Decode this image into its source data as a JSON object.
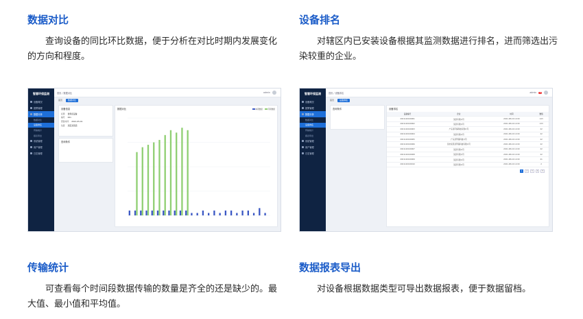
{
  "sections": {
    "compare": {
      "title": "数据对比",
      "desc": "查询设备的同比环比数据，便于分析在对比时期内发展变化的方向和程度。"
    },
    "ranking": {
      "title": "设备排名",
      "desc": "对辖区内已安装设备根据其监测数据进行排名，进而筛选出污染较重的企业。"
    },
    "transfer": {
      "title": "传输统计",
      "desc": "可查看每个时间段数据传输的数量是齐全的还是缺少的。最大值、最小值和平均值。"
    },
    "report": {
      "title": "数据报表导出",
      "desc": "对设备根据数据类型可导出数据报表，便于数据留档。"
    }
  },
  "screens": {
    "left": {
      "app_title": "智慧环保监测",
      "top_crumb": "首页 / 数据对比",
      "user_label": "admin",
      "tabs": [
        "首页",
        "数据对比"
      ],
      "info_title": "设备信息",
      "info_rows": [
        [
          "名称",
          "监测点设备"
        ],
        [
          "编号",
          "001"
        ],
        [
          "安装时间",
          "2021-05-01"
        ],
        [
          "位置",
          "某区某街道"
        ],
        [
          "所属企业",
          "某企业"
        ]
      ],
      "query_title": "查询条件",
      "chart_title": "数据对比",
      "legend": [
        "本期数据",
        "同期数据"
      ],
      "bars_series_a": [
        2,
        2,
        2,
        2,
        2,
        2,
        2,
        2,
        2,
        2,
        2,
        1,
        1,
        2,
        1,
        2,
        1,
        2,
        2,
        1,
        2,
        2,
        1,
        3,
        1
      ],
      "bars_series_b": [
        0,
        26,
        28,
        29,
        30,
        31,
        33,
        35,
        34,
        36,
        35,
        0,
        0,
        0,
        0,
        0,
        0,
        0,
        0,
        0,
        0,
        0,
        0,
        0,
        0
      ]
    },
    "right": {
      "app_title": "智慧环保监测",
      "top_crumb": "首页 / 设备排名",
      "user_label": "admin",
      "tabs": [
        "首页",
        "设备排名"
      ],
      "info_title": "查询条件",
      "list_title": "设备排名",
      "headers": [
        "设备编号",
        "企业",
        "时间",
        "数值"
      ],
      "rows": [
        [
          "2021120100001",
          "某某有限公司",
          "2021-08-16 12:00",
          "143"
        ],
        [
          "2021120100002",
          "某某有限公司",
          "2021-08-16 12:00",
          "133"
        ],
        [
          "2021120100003",
          "广东某环保科技有限公司",
          "2021-08-16 12:00",
          "22"
        ],
        [
          "2021120100004",
          "某某有限公司",
          "2021-08-16 12:00",
          "22"
        ],
        [
          "2021120100005",
          "广东某环保科技公司",
          "2021-08-16 12:00",
          "22"
        ],
        [
          "2021120100006",
          "某市某区某环保科技有限公司",
          "2021-08-16 12:00",
          "22"
        ],
        [
          "2021120100007",
          "某某有限公司",
          "2021-08-16 12:00",
          "22"
        ],
        [
          "2021120100008",
          "某某有限公司",
          "2021-08-16 12:00",
          "22"
        ],
        [
          "2021120100009",
          "某某有限公司",
          "2021-08-16 12:00",
          "21"
        ],
        [
          "2021120100010",
          "某某有限公司",
          "2021-08-16 12:00",
          "2"
        ]
      ],
      "pager": [
        "1",
        "2",
        "3",
        "4",
        "5"
      ]
    },
    "sidebar_items": [
      "设备概况",
      "报警管理",
      "数据分析",
      "数据对比",
      "设备排名",
      "传输统计",
      "报表导出",
      "系统管理",
      "用户管理",
      "日志管理"
    ]
  },
  "colors": {
    "accent": "#1b5cc8",
    "bar_a": "#3a57c4",
    "bar_b": "#8fcf72",
    "sidebar": "#0f2342"
  }
}
